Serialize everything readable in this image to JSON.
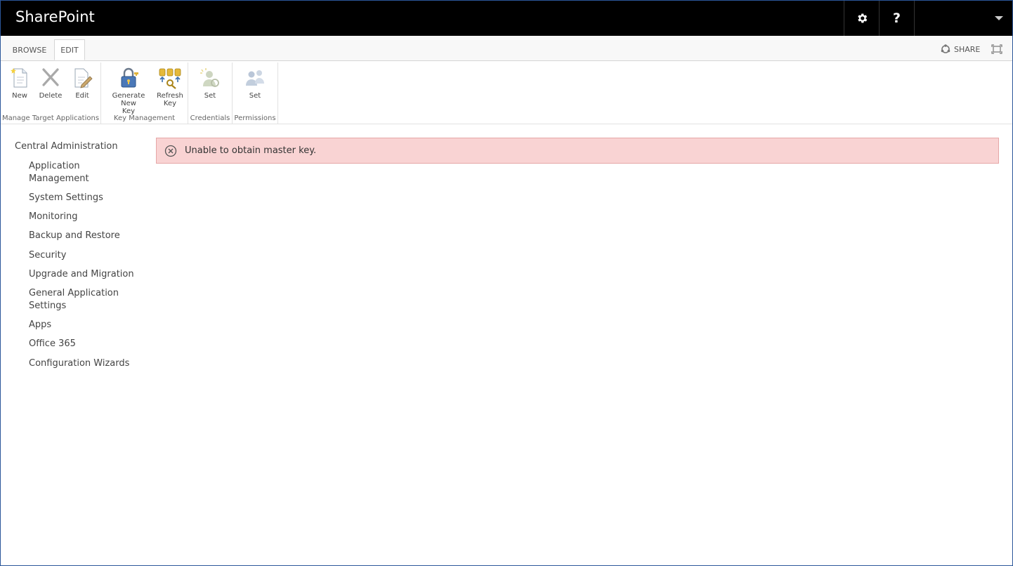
{
  "suite": {
    "brand": "SharePoint",
    "gear_icon": "gear-icon",
    "help_label": "?"
  },
  "ribbon_tabs": [
    {
      "label": "BROWSE",
      "selected": false
    },
    {
      "label": "EDIT",
      "selected": true
    }
  ],
  "share_label": "SHARE",
  "ribbon_groups": {
    "manage": {
      "label": "Manage Target Applications",
      "buttons": [
        {
          "label": "New",
          "icon": "new-icon"
        },
        {
          "label": "Delete",
          "icon": "delete-icon"
        },
        {
          "label": "Edit",
          "icon": "edit-icon"
        }
      ]
    },
    "key": {
      "label": "Key Management",
      "buttons": [
        {
          "label_line1": "Generate New",
          "label_line2": "Key",
          "icon": "lock-key-icon"
        },
        {
          "label_line1": "Refresh",
          "label_line2": "Key",
          "icon": "refresh-key-icon"
        }
      ]
    },
    "credentials": {
      "label": "Credentials",
      "buttons": [
        {
          "label": "Set",
          "icon": "credentials-icon"
        }
      ]
    },
    "permissions": {
      "label": "Permissions",
      "buttons": [
        {
          "label": "Set",
          "icon": "permissions-icon"
        }
      ]
    }
  },
  "nav": {
    "root": "Central Administration",
    "items": [
      "Application Management",
      "System Settings",
      "Monitoring",
      "Backup and Restore",
      "Security",
      "Upgrade and Migration",
      "General Application Settings",
      "Apps",
      "Office 365",
      "Configuration Wizards"
    ]
  },
  "error": {
    "message": "Unable to obtain master key.",
    "color_bg": "#f9d3d3"
  }
}
